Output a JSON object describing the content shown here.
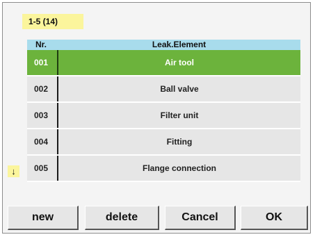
{
  "pager": {
    "label": "1-5 (14)"
  },
  "list": {
    "columns": {
      "nr": "Nr.",
      "element": "Leak.Element"
    },
    "rows": [
      {
        "nr": "001",
        "element": "Air tool",
        "selected": true
      },
      {
        "nr": "002",
        "element": "Ball valve",
        "selected": false
      },
      {
        "nr": "003",
        "element": "Filter unit",
        "selected": false
      },
      {
        "nr": "004",
        "element": "Fitting",
        "selected": false
      },
      {
        "nr": "005",
        "element": "Flange connection",
        "selected": false
      }
    ]
  },
  "scroll": {
    "icon": "arrow-down-icon",
    "glyph": "↓"
  },
  "buttons": {
    "new": "new",
    "delete": "delete",
    "cancel": "Cancel",
    "ok": "OK"
  },
  "colors": {
    "selected_row": "#6cb33c",
    "header": "#a8dcec",
    "badge": "#fbf59c",
    "row": "#e6e6e6"
  }
}
